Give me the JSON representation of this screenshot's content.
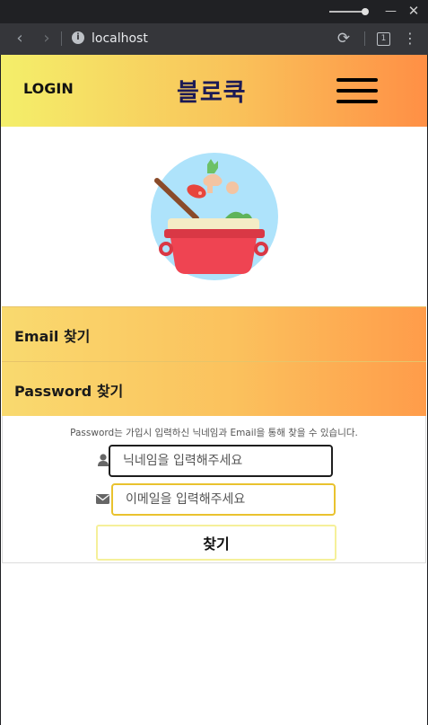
{
  "browser": {
    "url": "localhost",
    "tab_count": "1"
  },
  "header": {
    "login_label": "LOGIN",
    "logo": "블로쿡",
    "menu_icon": "hamburger-icon"
  },
  "hero": {
    "image": "cooking-pot-illustration"
  },
  "accordion": {
    "email_title": "Email 찾기",
    "password_title": "Password 찾기"
  },
  "password_form": {
    "hint": "Password는 가입시 입력하신 닉네임과 Email을 통해 찾을 수 있습니다.",
    "nickname_placeholder": "닉네임을 입력해주세요",
    "email_placeholder": "이메일을 입력해주세요",
    "submit_label": "찾기"
  },
  "colors": {
    "header_gradient": [
      "#f4ef6a",
      "#ff8f45"
    ],
    "logo_color": "#1c1a55",
    "email_input_border": "#e9c22e",
    "submit_border": "#f5f09a"
  }
}
